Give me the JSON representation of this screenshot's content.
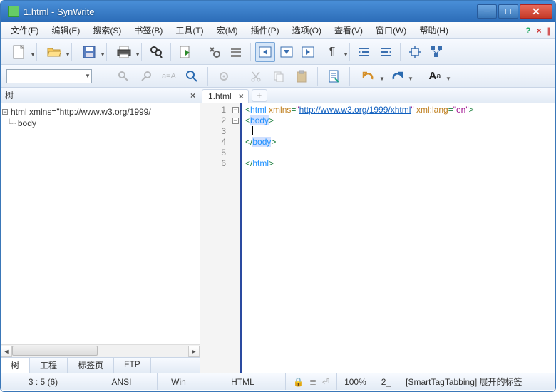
{
  "window": {
    "title": "1.html - SynWrite"
  },
  "menu": {
    "items": [
      "文件(F)",
      "编辑(E)",
      "搜索(S)",
      "书签(B)",
      "工具(T)",
      "宏(M)",
      "插件(P)",
      "选项(O)",
      "查看(V)",
      "窗口(W)",
      "帮助(H)"
    ]
  },
  "sidepanel": {
    "title": "树",
    "node1": "html xmlns=\"http://www.w3.org/1999/",
    "node2": "body",
    "tabs": {
      "t0": "树",
      "t1": "工程",
      "t2": "标签页",
      "t3": "FTP"
    }
  },
  "editor": {
    "tabname": "1.html",
    "addtab": "+",
    "lines": {
      "l1": "1",
      "l2": "2",
      "l3": "3",
      "l4": "4",
      "l5": "5",
      "l6": "6"
    },
    "code": {
      "r1a": "<",
      "r1b": "html",
      "r1c": " ",
      "r1d": "xmlns",
      "r1e": "=",
      "r1f": "\"",
      "r1g": "http://www.w3.org/1999/xhtml",
      "r1h": "\"",
      "r1i": " ",
      "r1j": "xml:lang",
      "r1k": "=",
      "r1l": "\"en\"",
      "r1m": ">",
      "r2a": "<",
      "r2b": "body",
      "r2c": ">",
      "r4a": "</",
      "r4b": "body",
      "r4c": ">",
      "r6a": "</",
      "r6b": "html",
      "r6c": ">"
    }
  },
  "status": {
    "pos": "3 : 5 (6)",
    "enc": "ANSI",
    "eol": "Win",
    "lang": "HTML",
    "zoom": "100%",
    "z2": "2_",
    "msg": "[SmartTagTabbing] 展开的标签"
  }
}
